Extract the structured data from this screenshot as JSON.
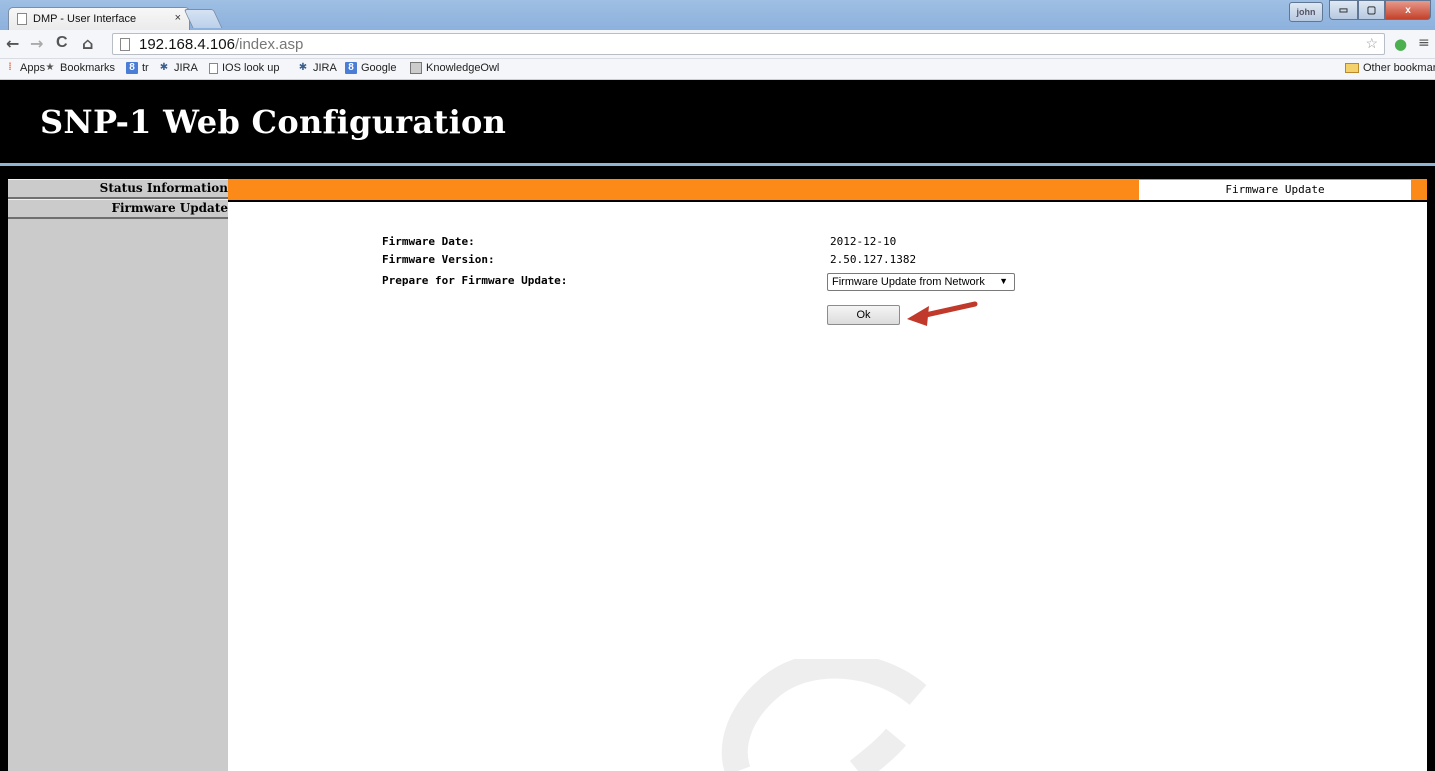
{
  "browser": {
    "tab_title": "DMP - User Interface",
    "tab_close": "×",
    "user_badge": "john",
    "min_glyph": "▭",
    "max_glyph": "▢",
    "close_glyph": "x",
    "url_host": "192.168.4.106",
    "url_path": "/index.asp",
    "nav": {
      "back": "←",
      "forward": "→",
      "reload": "C",
      "home": "⌂"
    },
    "toolbar_icons": [
      "star-icon",
      "evernote-icon",
      "extension-icon",
      "menu-icon"
    ],
    "bookmarks": [
      {
        "label": "Apps",
        "icon": "apps-icon"
      },
      {
        "label": "Bookmarks",
        "icon": "star-icon"
      },
      {
        "label": "tr",
        "icon": "google-icon"
      },
      {
        "label": "JIRA",
        "icon": "jira-icon"
      },
      {
        "label": "IOS look up",
        "icon": "page-icon"
      },
      {
        "label": "JIRA",
        "icon": "jira-icon"
      },
      {
        "label": "Google",
        "icon": "google-icon"
      },
      {
        "label": "KnowledgeOwl",
        "icon": "owl-icon"
      }
    ],
    "other_bookmarks": "Other bookmarks"
  },
  "page": {
    "title": "SNP-1 Web Configuration"
  },
  "sidebar": {
    "items": [
      {
        "label": "Status Information"
      },
      {
        "label": "Firmware Update"
      }
    ]
  },
  "main": {
    "section_tab": "Firmware Update",
    "firmware_date_label": "Firmware Date:",
    "firmware_date_value": "2012-12-10",
    "firmware_version_label": "Firmware Version:",
    "firmware_version_value": "2.50.127.1382",
    "prepare_label": "Prepare for Firmware Update:",
    "prepare_select_value": "Firmware Update from Network",
    "ok_label": "Ok"
  },
  "colors": {
    "orange": "#fb8a18",
    "annotation_arrow": "#c0392b"
  }
}
